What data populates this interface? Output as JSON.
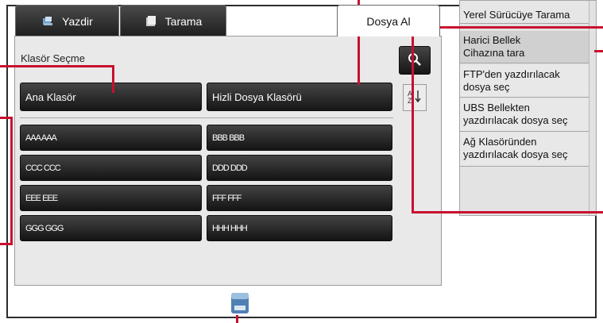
{
  "tabs": [
    {
      "label": "Yazdir",
      "icon": "printer-icon"
    },
    {
      "label": "Tarama",
      "icon": "scan-icon"
    },
    {
      "label": "Dosya Al"
    }
  ],
  "panel": {
    "title": "Klasör Seçme"
  },
  "folder_buttons": {
    "main": "Ana Klasör",
    "quick": "Hizli Dosya Klasörü"
  },
  "files": [
    "AAA AAA",
    "BBB BBB",
    "CCC CCC",
    "DDD DDD",
    "EEE EEE",
    "FFF FFF",
    "GGG GGG",
    "HHH HHH"
  ],
  "tools": {
    "search_icon": "magnifier-icon",
    "sort_icon": "sort-az-icon"
  },
  "side_menu": {
    "title": "Yerel Sürücüye Tarama",
    "items": [
      "Harici Bellek\nCihazına tara",
      "FTP'den yazdırılacak\ndosya seç",
      "UBS Bellekten\nyazdırılacak dosya seç",
      "Ağ Klasöründen\nyazdırılacak dosya seç"
    ]
  },
  "storage_icon": "usb-storage-icon",
  "colors": {
    "callout": "#c8102e",
    "button_dark": "#1e1e1e",
    "panel_bg": "#e9e9e9"
  }
}
